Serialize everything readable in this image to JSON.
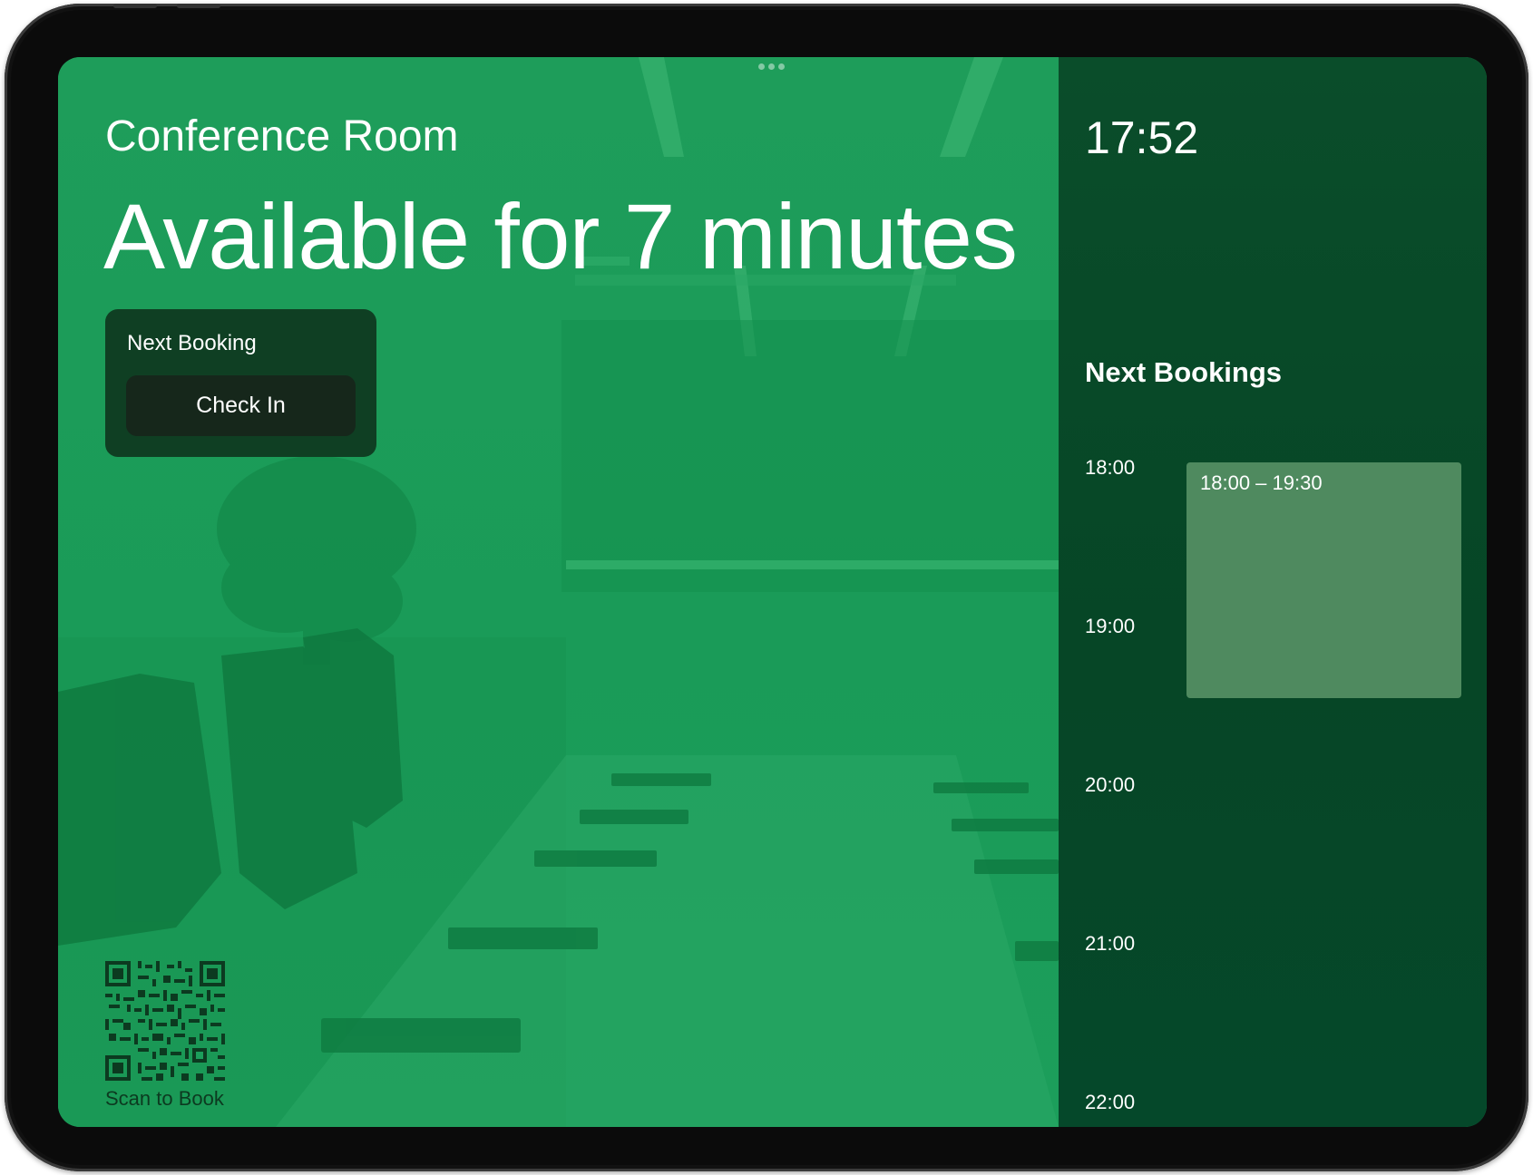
{
  "app": {
    "room_name": "Conference Room",
    "status_text": "Available for 7 minutes",
    "colors": {
      "available_green": "#1a9b58",
      "sidebar_green": "#064626",
      "card_dark": "#0f3f23",
      "button_dark": "#16271b",
      "booking_block": "#4f8a5f"
    }
  },
  "next_booking_card": {
    "label": "Next Booking",
    "check_in_label": "Check In"
  },
  "qr": {
    "icon": "qr-code-icon",
    "label": "Scan to Book"
  },
  "sidebar": {
    "clock": "17:52",
    "title": "Next Bookings",
    "hours": [
      "18:00",
      "19:00",
      "20:00",
      "21:00",
      "22:00"
    ],
    "bookings": [
      {
        "time_range": "18:00 – 19:30"
      }
    ]
  }
}
